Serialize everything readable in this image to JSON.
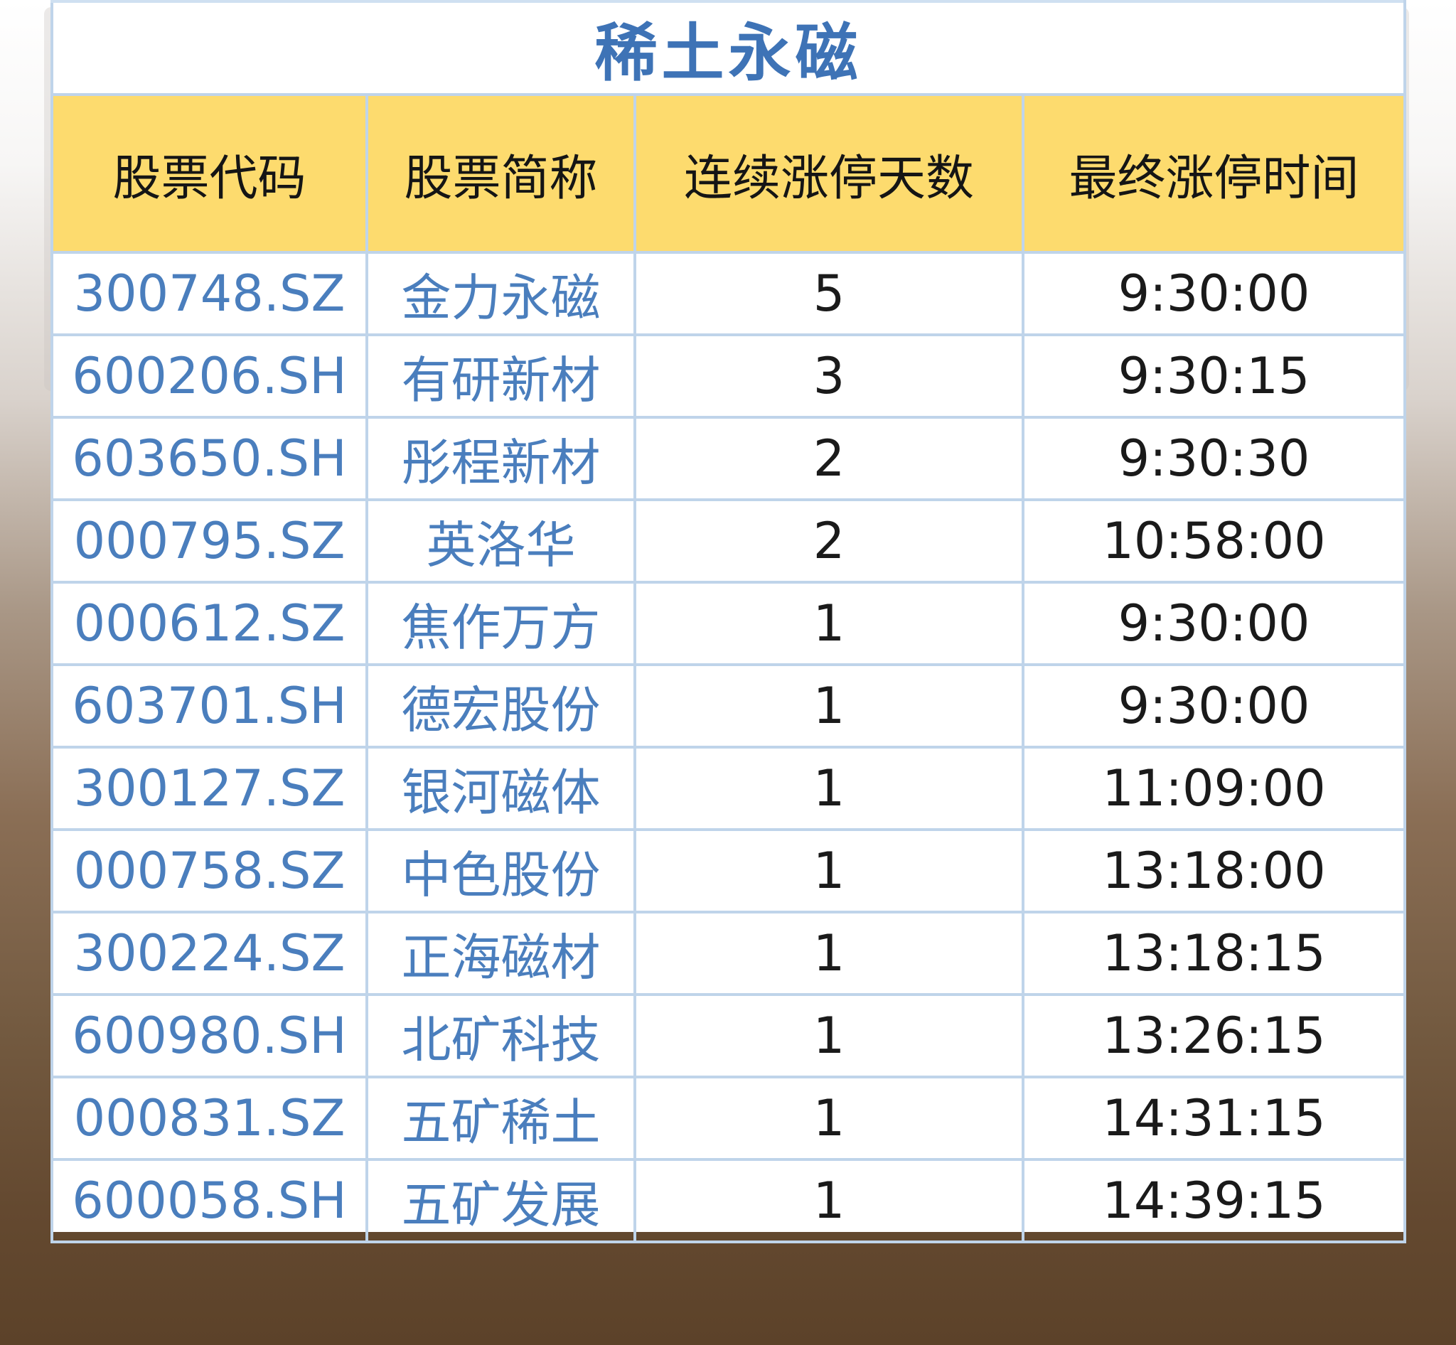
{
  "table": {
    "title": "稀土永磁",
    "headers": [
      "股票代码",
      "股票简称",
      "连续涨停天数",
      "最终涨停时间"
    ],
    "rows": [
      {
        "code": "300748.SZ",
        "name": "金力永磁",
        "days": "5",
        "time": "9:30:00"
      },
      {
        "code": "600206.SH",
        "name": "有研新材",
        "days": "3",
        "time": "9:30:15"
      },
      {
        "code": "603650.SH",
        "name": "彤程新材",
        "days": "2",
        "time": "9:30:30"
      },
      {
        "code": "000795.SZ",
        "name": "英洛华",
        "days": "2",
        "time": "10:58:00"
      },
      {
        "code": "000612.SZ",
        "name": "焦作万方",
        "days": "1",
        "time": "9:30:00"
      },
      {
        "code": "603701.SH",
        "name": "德宏股份",
        "days": "1",
        "time": "9:30:00"
      },
      {
        "code": "300127.SZ",
        "name": "银河磁体",
        "days": "1",
        "time": "11:09:00"
      },
      {
        "code": "000758.SZ",
        "name": "中色股份",
        "days": "1",
        "time": "13:18:00"
      },
      {
        "code": "300224.SZ",
        "name": "正海磁材",
        "days": "1",
        "time": "13:18:15"
      },
      {
        "code": "600980.SH",
        "name": "北矿科技",
        "days": "1",
        "time": "13:26:15"
      },
      {
        "code": "000831.SZ",
        "name": "五矿稀土",
        "days": "1",
        "time": "14:31:15"
      },
      {
        "code": "600058.SH",
        "name": "五矿发展",
        "days": "1",
        "time": "14:39:15"
      }
    ]
  },
  "colors": {
    "header_bg": "#fddb6e",
    "title_text": "#3e73b6",
    "code_text": "#4a7ebd",
    "grid_line": "#bfd4ea"
  }
}
